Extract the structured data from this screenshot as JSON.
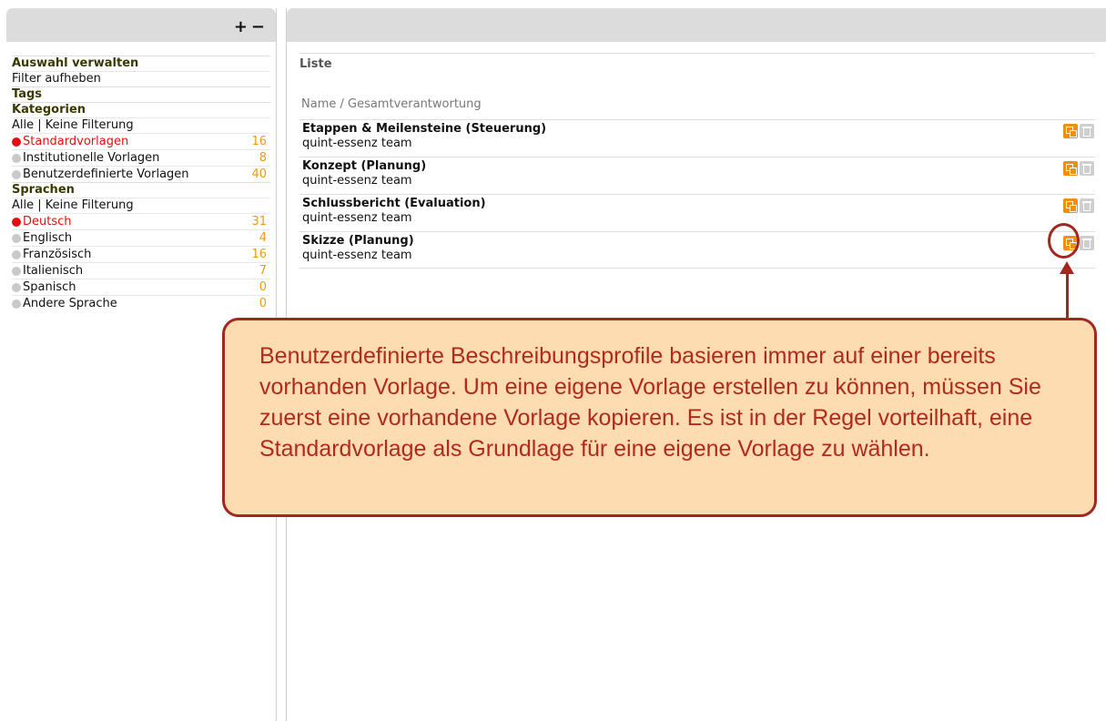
{
  "left_panel": {
    "tools": {
      "add": "+",
      "remove": "−"
    },
    "manage": {
      "title": "Auswahl verwalten",
      "reset_filter": "Filter aufheben"
    },
    "tags": {
      "title": "Tags"
    },
    "categories": {
      "title": "Kategorien",
      "all_link": "Alle",
      "separator": "|",
      "none_link": "Keine Filterung",
      "items": [
        {
          "label": "Standardvorlagen",
          "count": "16",
          "active": true
        },
        {
          "label": "Institutionelle Vorlagen",
          "count": "8",
          "active": false
        },
        {
          "label": "Benutzerdefinierte Vorlagen",
          "count": "40",
          "active": false
        }
      ]
    },
    "languages": {
      "title": "Sprachen",
      "all_link": "Alle",
      "separator": "|",
      "none_link": "Keine Filterung",
      "items": [
        {
          "label": "Deutsch",
          "count": "31",
          "active": true
        },
        {
          "label": "Englisch",
          "count": "4",
          "active": false
        },
        {
          "label": "Französisch",
          "count": "16",
          "active": false
        },
        {
          "label": "Italienisch",
          "count": "7",
          "active": false
        },
        {
          "label": "Spanisch",
          "count": "0",
          "active": false
        },
        {
          "label": "Andere Sprache",
          "count": "0",
          "active": false
        }
      ]
    }
  },
  "main": {
    "section_title": "Liste",
    "column_header": "Name / Gesamtverantwortung",
    "rows": [
      {
        "name": "Etappen & Meilensteine (Steuerung)",
        "owner": "quint-essenz team"
      },
      {
        "name": "Konzept (Planung)",
        "owner": "quint-essenz team"
      },
      {
        "name": "Schlussbericht (Evaluation)",
        "owner": "quint-essenz team"
      },
      {
        "name": "Skizze (Planung)",
        "owner": "quint-essenz team"
      }
    ]
  },
  "callout": {
    "text": "Benutzerdefinierte Beschreibungsprofile basieren immer auf einer bereits vorhanden Vorlage. Um eine eigene Vorlage erstellen zu können, müssen Sie zuerst eine vorhandene Vorlage kopieren. Es ist in der Regel vorteilhaft, eine Standardvorlage als Grundlage für eine eigene Vorlage zu wählen."
  },
  "colors": {
    "accent_orange": "#f28f10",
    "active_red": "#e41010",
    "callout_border": "#a0281c",
    "callout_bg": "#fcdcb0"
  }
}
